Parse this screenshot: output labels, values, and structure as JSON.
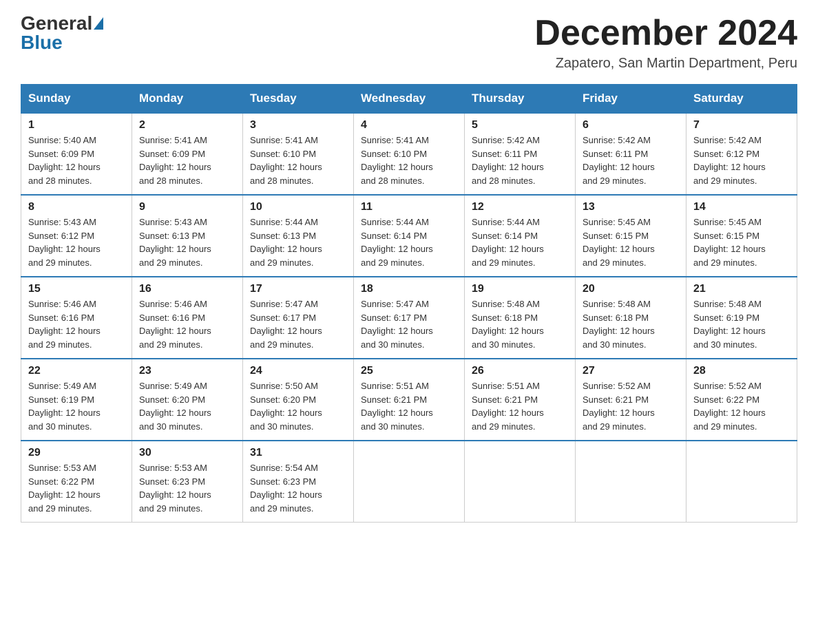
{
  "logo": {
    "general": "General",
    "blue": "Blue"
  },
  "header": {
    "month": "December 2024",
    "location": "Zapatero, San Martin Department, Peru"
  },
  "days_of_week": [
    "Sunday",
    "Monday",
    "Tuesday",
    "Wednesday",
    "Thursday",
    "Friday",
    "Saturday"
  ],
  "weeks": [
    [
      {
        "day": "1",
        "sunrise": "5:40 AM",
        "sunset": "6:09 PM",
        "daylight": "12 hours and 28 minutes."
      },
      {
        "day": "2",
        "sunrise": "5:41 AM",
        "sunset": "6:09 PM",
        "daylight": "12 hours and 28 minutes."
      },
      {
        "day": "3",
        "sunrise": "5:41 AM",
        "sunset": "6:10 PM",
        "daylight": "12 hours and 28 minutes."
      },
      {
        "day": "4",
        "sunrise": "5:41 AM",
        "sunset": "6:10 PM",
        "daylight": "12 hours and 28 minutes."
      },
      {
        "day": "5",
        "sunrise": "5:42 AM",
        "sunset": "6:11 PM",
        "daylight": "12 hours and 28 minutes."
      },
      {
        "day": "6",
        "sunrise": "5:42 AM",
        "sunset": "6:11 PM",
        "daylight": "12 hours and 29 minutes."
      },
      {
        "day": "7",
        "sunrise": "5:42 AM",
        "sunset": "6:12 PM",
        "daylight": "12 hours and 29 minutes."
      }
    ],
    [
      {
        "day": "8",
        "sunrise": "5:43 AM",
        "sunset": "6:12 PM",
        "daylight": "12 hours and 29 minutes."
      },
      {
        "day": "9",
        "sunrise": "5:43 AM",
        "sunset": "6:13 PM",
        "daylight": "12 hours and 29 minutes."
      },
      {
        "day": "10",
        "sunrise": "5:44 AM",
        "sunset": "6:13 PM",
        "daylight": "12 hours and 29 minutes."
      },
      {
        "day": "11",
        "sunrise": "5:44 AM",
        "sunset": "6:14 PM",
        "daylight": "12 hours and 29 minutes."
      },
      {
        "day": "12",
        "sunrise": "5:44 AM",
        "sunset": "6:14 PM",
        "daylight": "12 hours and 29 minutes."
      },
      {
        "day": "13",
        "sunrise": "5:45 AM",
        "sunset": "6:15 PM",
        "daylight": "12 hours and 29 minutes."
      },
      {
        "day": "14",
        "sunrise": "5:45 AM",
        "sunset": "6:15 PM",
        "daylight": "12 hours and 29 minutes."
      }
    ],
    [
      {
        "day": "15",
        "sunrise": "5:46 AM",
        "sunset": "6:16 PM",
        "daylight": "12 hours and 29 minutes."
      },
      {
        "day": "16",
        "sunrise": "5:46 AM",
        "sunset": "6:16 PM",
        "daylight": "12 hours and 29 minutes."
      },
      {
        "day": "17",
        "sunrise": "5:47 AM",
        "sunset": "6:17 PM",
        "daylight": "12 hours and 29 minutes."
      },
      {
        "day": "18",
        "sunrise": "5:47 AM",
        "sunset": "6:17 PM",
        "daylight": "12 hours and 30 minutes."
      },
      {
        "day": "19",
        "sunrise": "5:48 AM",
        "sunset": "6:18 PM",
        "daylight": "12 hours and 30 minutes."
      },
      {
        "day": "20",
        "sunrise": "5:48 AM",
        "sunset": "6:18 PM",
        "daylight": "12 hours and 30 minutes."
      },
      {
        "day": "21",
        "sunrise": "5:48 AM",
        "sunset": "6:19 PM",
        "daylight": "12 hours and 30 minutes."
      }
    ],
    [
      {
        "day": "22",
        "sunrise": "5:49 AM",
        "sunset": "6:19 PM",
        "daylight": "12 hours and 30 minutes."
      },
      {
        "day": "23",
        "sunrise": "5:49 AM",
        "sunset": "6:20 PM",
        "daylight": "12 hours and 30 minutes."
      },
      {
        "day": "24",
        "sunrise": "5:50 AM",
        "sunset": "6:20 PM",
        "daylight": "12 hours and 30 minutes."
      },
      {
        "day": "25",
        "sunrise": "5:51 AM",
        "sunset": "6:21 PM",
        "daylight": "12 hours and 30 minutes."
      },
      {
        "day": "26",
        "sunrise": "5:51 AM",
        "sunset": "6:21 PM",
        "daylight": "12 hours and 29 minutes."
      },
      {
        "day": "27",
        "sunrise": "5:52 AM",
        "sunset": "6:21 PM",
        "daylight": "12 hours and 29 minutes."
      },
      {
        "day": "28",
        "sunrise": "5:52 AM",
        "sunset": "6:22 PM",
        "daylight": "12 hours and 29 minutes."
      }
    ],
    [
      {
        "day": "29",
        "sunrise": "5:53 AM",
        "sunset": "6:22 PM",
        "daylight": "12 hours and 29 minutes."
      },
      {
        "day": "30",
        "sunrise": "5:53 AM",
        "sunset": "6:23 PM",
        "daylight": "12 hours and 29 minutes."
      },
      {
        "day": "31",
        "sunrise": "5:54 AM",
        "sunset": "6:23 PM",
        "daylight": "12 hours and 29 minutes."
      },
      null,
      null,
      null,
      null
    ]
  ],
  "labels": {
    "sunrise": "Sunrise:",
    "sunset": "Sunset:",
    "daylight": "Daylight:"
  }
}
